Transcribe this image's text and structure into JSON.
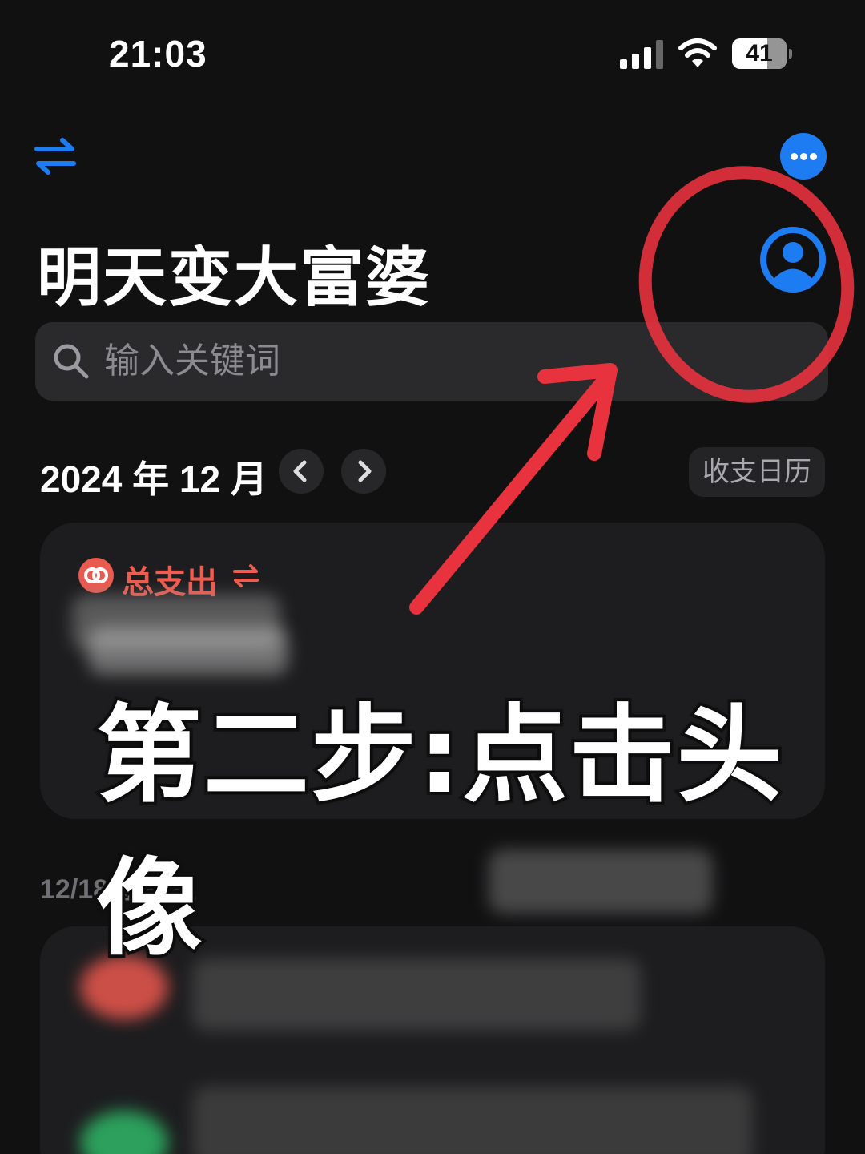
{
  "status_bar": {
    "time": "21:03",
    "battery": "41"
  },
  "header": {
    "swap_icon": "swap-arrows-icon",
    "more_icon": "ellipsis-icon",
    "avatar_icon": "person-avatar-icon",
    "title": "明天变大富婆"
  },
  "search": {
    "placeholder": "输入关键词",
    "value": ""
  },
  "month_nav": {
    "label": "2024 年 12 月",
    "prev_icon": "chevron-left-icon",
    "next_icon": "chevron-right-icon",
    "calendar_button": "收支日历"
  },
  "summary_card": {
    "title": "总支出",
    "badge_icon": "linked-circles-icon",
    "toggle_icon": "swap-arrows-icon"
  },
  "day_section": {
    "date": "12/18 星期三"
  },
  "annotation": {
    "text": "第二步:点击头像",
    "color": "#e8323e"
  },
  "colors": {
    "background": "#111112",
    "accent_blue": "#1e7cf2",
    "expense_red": "#ef5c50",
    "card": "#1d1d1f"
  }
}
